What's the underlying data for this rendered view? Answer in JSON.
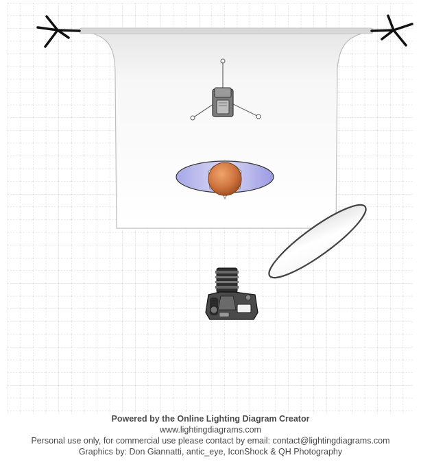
{
  "diagram": {
    "items": [
      {
        "kind": "background-stand",
        "label": "background paper with stands"
      },
      {
        "kind": "light",
        "label": "flash head on tripod"
      },
      {
        "kind": "subject",
        "label": "model seen from above"
      },
      {
        "kind": "reflector",
        "label": "silver reflector"
      },
      {
        "kind": "camera",
        "label": "DSLR camera"
      }
    ]
  },
  "footer": {
    "line1": "Powered by the Online Lighting Diagram Creator",
    "line2": "www.lightingdiagrams.com",
    "line3": "Personal use only, for commercial use please contact by email: contact@lightingdiagrams.com",
    "line4": "Graphics by: Don Giannatti, antic_eye, IconShock & QH Photography"
  }
}
